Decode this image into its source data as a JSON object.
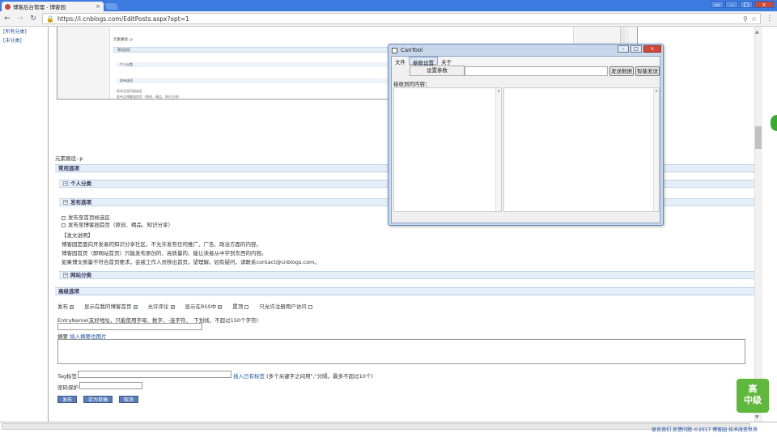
{
  "browser": {
    "tab_title": "博客后台管理 - 博客园",
    "url": "https://i.cnblogs.com/EditPosts.aspx?opt=1"
  },
  "sidebar": {
    "items": [
      {
        "label": "[所有分类]"
      },
      {
        "label": "[未分类]"
      }
    ]
  },
  "preview": {
    "elpath": "元素路径: p",
    "common_options": "常用选项",
    "personal_category": "个人分类",
    "publish_options": "发布选项",
    "check1": "发布至首页候选区",
    "check2": "发布至博客园首页（原创、精品、知识分享）"
  },
  "editor": {
    "elpath": "元素路径: p",
    "common_options": "常用选项",
    "personal_category": "个人分类",
    "publish_options": "发布选项",
    "check1": "发布至首页候选区",
    "check2": "发布至博客园首页（原创、精品、知识分享）",
    "notice_title": "【发文说明】",
    "notice_lines": [
      "博客园是面向开发者的知识分享社区，不允许发布任何推广、广告、政治方面的内容。",
      "博客园首页（即网站首页）只能发布原创的、高质量的、能让读者从中学到东西的内容。",
      "如果博文质量不符合首页要求，会被工作人员移出首页，望理解。如有疑问，请联系contact@cnblogs.com。"
    ],
    "site_category": "网站分类",
    "advanced_options": "高级选项",
    "adv_checks": [
      {
        "label": "发布",
        "checked": true
      },
      {
        "label": "显示在我的博客首页",
        "checked": true
      },
      {
        "label": "允许评论",
        "checked": true
      },
      {
        "label": "显示在RSS中",
        "checked": true
      },
      {
        "label": "置顶",
        "checked": false
      },
      {
        "label": "只允许注册用户访问",
        "checked": false
      }
    ],
    "entryname_label": "EntryName(友好地址，只能使用字母、数字、-连字符、_下划线，不超过150个字符)",
    "summary_label": "摘要",
    "insert_image_link": "插入摘要也图片",
    "tag_label": "Tag标签",
    "tag_link": "插入已有标签",
    "tag_hint": "(多个关键字之间用\",\"分隔，最多不超过10个)",
    "password_label": "密码保护",
    "buttons": {
      "publish": "发布",
      "draft": "存为草稿",
      "cancel": "取消"
    }
  },
  "footer": {
    "text": "联系我们 反馈问题 ©2017 博客园 技术改变世界"
  },
  "widget": {
    "line1": "高",
    "line2": "中级"
  },
  "cantool": {
    "title": "CanTool",
    "menu": [
      "文件",
      "参数设置",
      "关于"
    ],
    "dropdown_item": "设置参数",
    "send_button": "发送数据",
    "auto_send_button": "智能发送",
    "received_label": "接收到的内容："
  },
  "colors": {
    "tabbar": "#3b7be0",
    "section_bar": "#e4eef8",
    "button": "#5a7db8",
    "link": "#2050a0"
  }
}
